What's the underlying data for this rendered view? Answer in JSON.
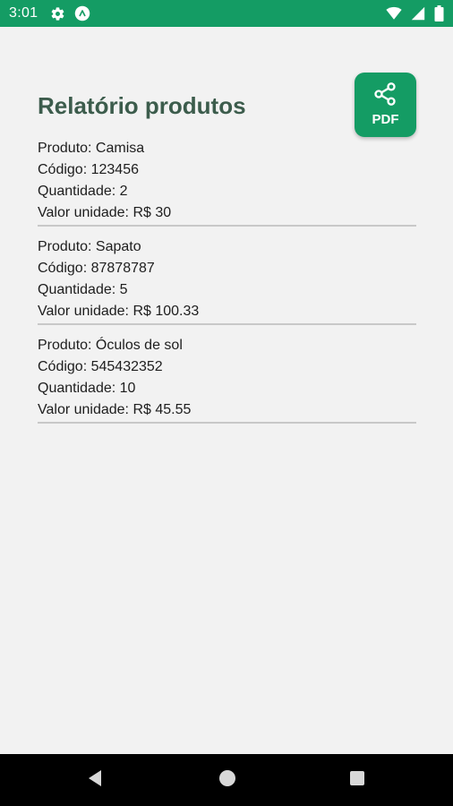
{
  "status_bar": {
    "time": "3:01",
    "icons": [
      "settings-icon",
      "android-icon",
      "wifi-icon",
      "signal-icon",
      "battery-icon"
    ]
  },
  "page": {
    "title": "Relatório produtos"
  },
  "pdf_button": {
    "label": "PDF",
    "icon": "share-icon"
  },
  "products": [
    {
      "name": "Produto: Camisa",
      "code": "Código: 123456",
      "quantity": "Quantidade: 2",
      "unit_value": "Valor unidade: R$ 30"
    },
    {
      "name": "Produto: Sapato",
      "code": "Código: 87878787",
      "quantity": "Quantidade: 5",
      "unit_value": "Valor unidade: R$ 100.33"
    },
    {
      "name": "Produto: Óculos de sol",
      "code": "Código: 545432352",
      "quantity": "Quantidade: 10",
      "unit_value": "Valor unidade: R$ 45.55"
    }
  ],
  "nav_bar": {
    "buttons": [
      "back-icon",
      "home-icon",
      "recents-icon"
    ]
  },
  "colors": {
    "status_bar": "#149c64",
    "accent": "#149c64",
    "title": "#3c5c4c",
    "background": "#f2f2f2",
    "divider": "#c8c8c8",
    "nav_bar": "#000000"
  }
}
